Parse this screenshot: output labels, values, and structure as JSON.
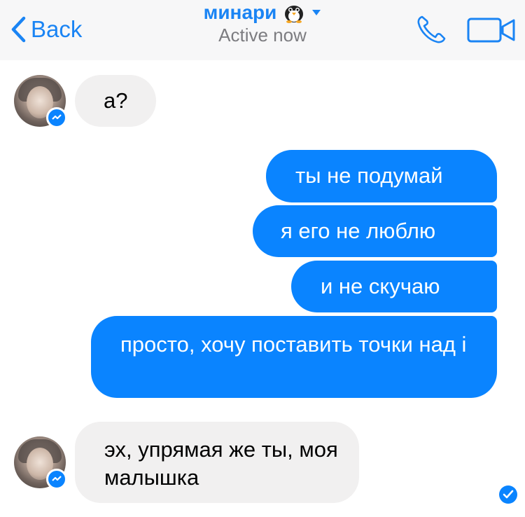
{
  "header": {
    "back_label": "Back",
    "contact_name": "минари",
    "name_emoji": "penguin-emoji",
    "status": "Active now",
    "accent_color": "#1a84f4",
    "icons": [
      "chevron-left-icon",
      "phone-icon",
      "video-camera-icon",
      "chevron-down-icon"
    ]
  },
  "messages": [
    {
      "direction": "incoming",
      "text": "а?"
    },
    {
      "direction": "outgoing",
      "text": "ты не подумай"
    },
    {
      "direction": "outgoing",
      "text": "я его не люблю"
    },
    {
      "direction": "outgoing",
      "text": "и не скучаю"
    },
    {
      "direction": "outgoing",
      "text": "просто, хочу поставить точки над і"
    },
    {
      "direction": "incoming",
      "text": "эх, упрямая же ты, моя малышка"
    }
  ],
  "colors": {
    "outgoing_bubble": "#0a84ff",
    "incoming_bubble": "#f1f0f0",
    "header_background": "#f7f7f8"
  },
  "read_receipt": "seen-check-icon"
}
